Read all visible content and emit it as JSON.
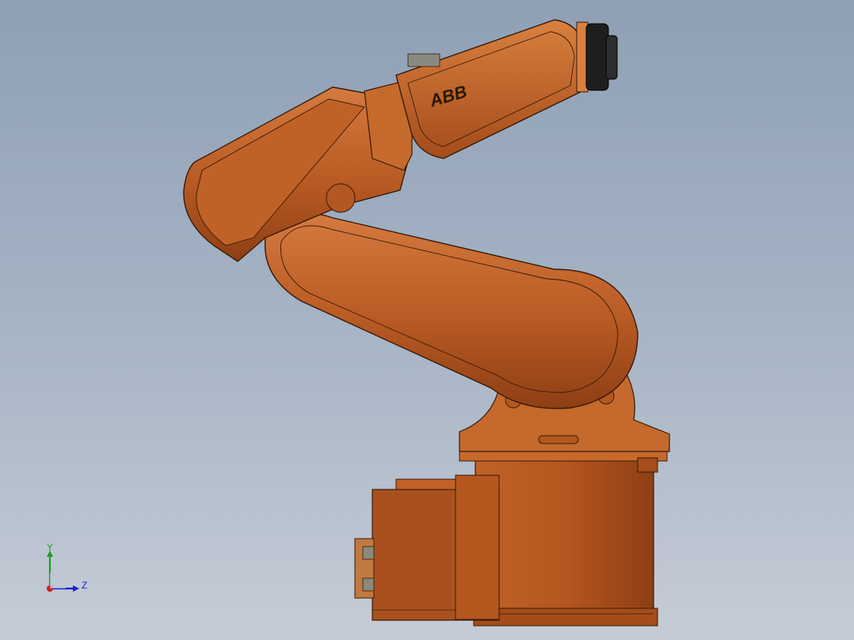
{
  "model": {
    "logo_text": "ABB"
  },
  "triad": {
    "y_label": "Y",
    "z_label": "Z",
    "colors": {
      "y_axis": "#1aa31a",
      "z_axis": "#1a1ad6",
      "x_axis": "#d11a1a"
    }
  },
  "colors": {
    "robot_body": "#b85a23",
    "robot_highlight": "#d2773c",
    "robot_shadow": "#8d3f14",
    "robot_edge": "#3a1a08",
    "end_flange": "#1e1e1e",
    "background_top": "#8fa0b5",
    "background_bottom": "#c5ccd6"
  }
}
